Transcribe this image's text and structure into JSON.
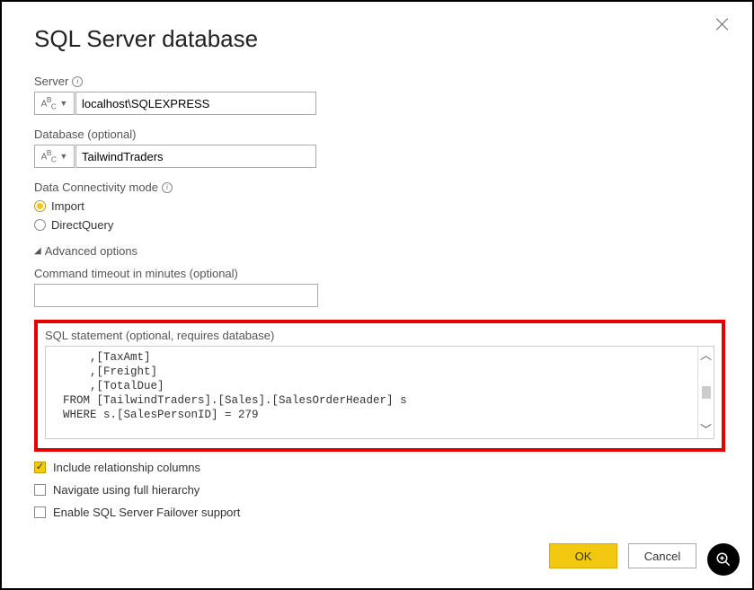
{
  "dialog": {
    "title": "SQL Server database",
    "server_label": "Server",
    "server_value": "localhost\\SQLEXPRESS",
    "database_label": "Database (optional)",
    "database_value": "TailwindTraders",
    "type_btn_label": "ABC",
    "connectivity_label": "Data Connectivity mode",
    "radio_import": "Import",
    "radio_directquery": "DirectQuery",
    "advanced_label": "Advanced options",
    "timeout_label": "Command timeout in minutes (optional)",
    "timeout_value": "",
    "sql_label": "SQL statement (optional, requires database)",
    "sql_text": "      ,[TaxAmt]\n      ,[Freight]\n      ,[TotalDue]\n  FROM [TailwindTraders].[Sales].[SalesOrderHeader] s\n  WHERE s.[SalesPersonID] = 279",
    "chk_relationship": "Include relationship columns",
    "chk_hierarchy": "Navigate using full hierarchy",
    "chk_failover": "Enable SQL Server Failover support",
    "ok": "OK",
    "cancel": "Cancel"
  }
}
